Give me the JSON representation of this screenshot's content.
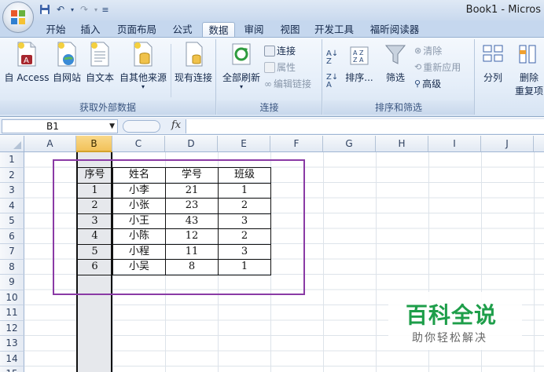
{
  "window": {
    "title": "Book1 - Micros"
  },
  "tabs": [
    {
      "label": "开始"
    },
    {
      "label": "插入"
    },
    {
      "label": "页面布局"
    },
    {
      "label": "公式"
    },
    {
      "label": "数据"
    },
    {
      "label": "审阅"
    },
    {
      "label": "视图"
    },
    {
      "label": "开发工具"
    },
    {
      "label": "福昕阅读器"
    }
  ],
  "active_tab": "数据",
  "ribbon": {
    "get_external": {
      "label": "获取外部数据",
      "buttons": [
        "自 Access",
        "自网站",
        "自文本",
        "自其他来源",
        "现有连接"
      ]
    },
    "connections": {
      "label": "连接",
      "refresh_all": "全部刷新",
      "connect": "连接",
      "properties": "属性",
      "edit_links": "编辑链接"
    },
    "sort_filter": {
      "label": "排序和筛选",
      "sort": "排序...",
      "filter": "筛选",
      "clear": "清除",
      "reapply": "重新应用",
      "advanced": "高级"
    },
    "data_tools": {
      "text_to_columns": "分列",
      "remove_dup_1": "删除",
      "remove_dup_2": "重复项"
    }
  },
  "formula_bar": {
    "name_box": "B1",
    "fx_label": "fx",
    "formula": ""
  },
  "columns": [
    "A",
    "B",
    "C",
    "D",
    "E",
    "F",
    "G",
    "H",
    "I",
    "J"
  ],
  "selected_column": "B",
  "rows": [
    "1",
    "2",
    "3",
    "4",
    "5",
    "6",
    "7",
    "8",
    "9",
    "10",
    "11",
    "12",
    "13",
    "14",
    "15"
  ],
  "table": {
    "headers": [
      "序号",
      "姓名",
      "学号",
      "班级"
    ],
    "rows": [
      [
        "1",
        "小李",
        "21",
        "1"
      ],
      [
        "2",
        "小张",
        "23",
        "2"
      ],
      [
        "3",
        "小王",
        "43",
        "3"
      ],
      [
        "4",
        "小陈",
        "12",
        "2"
      ],
      [
        "5",
        "小程",
        "11",
        "3"
      ],
      [
        "6",
        "小吴",
        "8",
        "1"
      ]
    ]
  },
  "watermark": {
    "title": "百科全说",
    "subtitle": "助你轻松解决"
  },
  "colors": {
    "accent_purple": "#8a3aa5",
    "watermark_green": "#1e9e4a",
    "ribbon_blue": "#c5d7ee"
  }
}
